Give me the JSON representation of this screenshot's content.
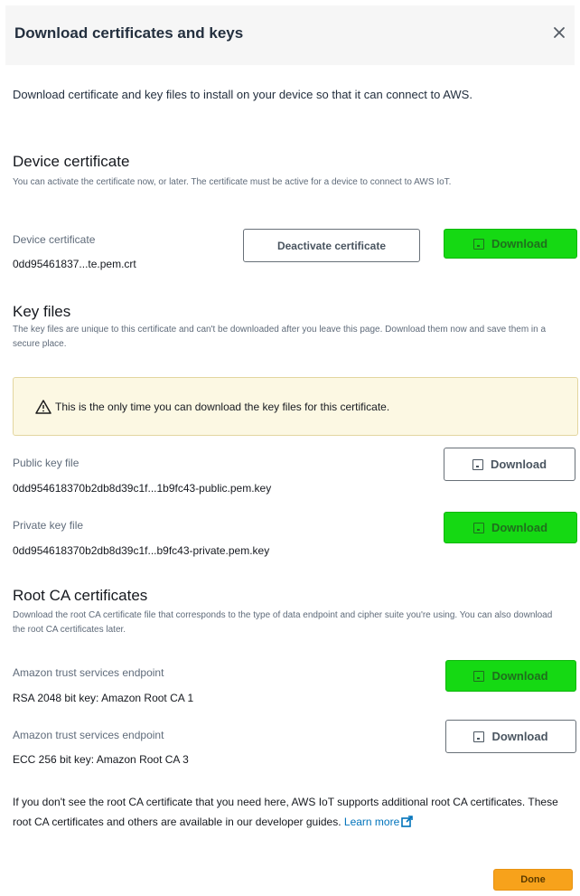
{
  "dialog": {
    "title": "Download certificates and keys",
    "intro": "Download certificate and key files to install on your device so that it can connect to AWS."
  },
  "device_certificate": {
    "heading": "Device certificate",
    "description": "You can activate the certificate now, or later. The certificate must be active for a device to connect to AWS IoT.",
    "label": "Device certificate",
    "filename": "0dd95461837...te.pem.crt",
    "deactivate_label": "Deactivate certificate",
    "download_label": "Download"
  },
  "key_files": {
    "heading": "Key files",
    "description": "The key files are unique to this certificate and can't be downloaded after you leave this page. Download them now and save them in a secure place.",
    "alert": "This is the only time you can download the key files for this certificate.",
    "public_label": "Public key file",
    "public_filename": "0dd954618370b2db8d39c1f...1b9fc43-public.pem.key",
    "public_download": "Download",
    "private_label": "Private key file",
    "private_filename": "0dd954618370b2db8d39c1f...b9fc43-private.pem.key",
    "private_download": "Download"
  },
  "root_ca": {
    "heading": "Root CA certificates",
    "description": "Download the root CA certificate file that corresponds to the type of data endpoint and cipher suite you're using. You can also download the root CA certificates later.",
    "rsa_label": "Amazon trust services endpoint",
    "rsa_value": "RSA 2048 bit key: Amazon Root CA 1",
    "rsa_download": "Download",
    "ecc_label": "Amazon trust services endpoint",
    "ecc_value": "ECC 256 bit key: Amazon Root CA 3",
    "ecc_download": "Download"
  },
  "footer": {
    "text": "If you don't see the root CA certificate that you need here, AWS IoT supports additional root CA certificates. These root CA certificates and others are available in our developer guides.",
    "learn_more": "Learn more",
    "done_label": "Done"
  },
  "colors": {
    "highlight_green": "#15d913",
    "done_orange": "#f7a21b",
    "link_blue": "#0073bb",
    "alert_bg": "#fcf8e3"
  },
  "icons": [
    "close-icon",
    "download-icon",
    "warning-icon",
    "external-link-icon"
  ]
}
